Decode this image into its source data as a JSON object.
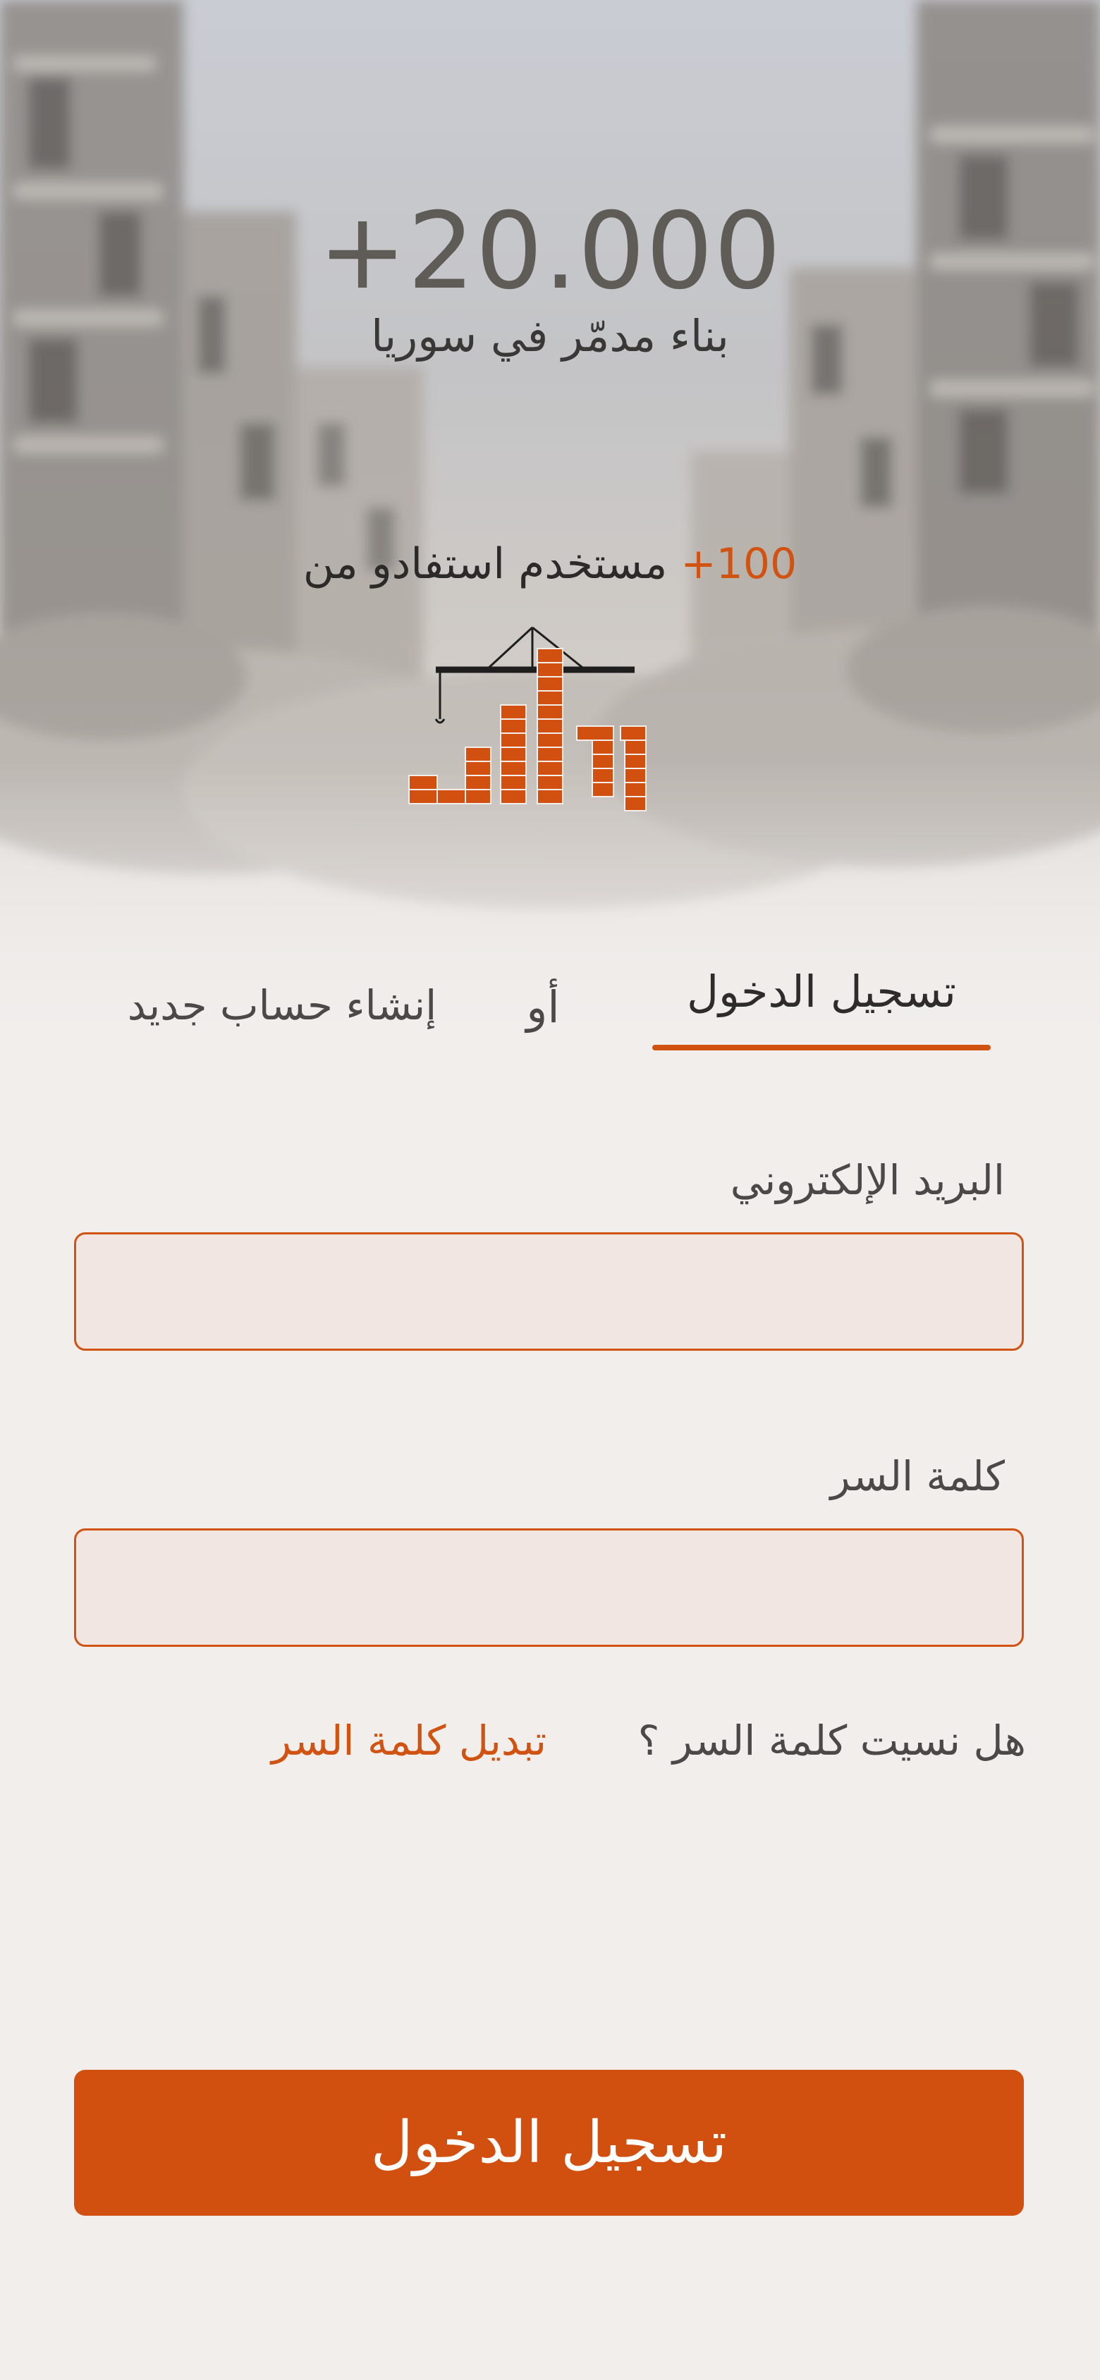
{
  "hero": {
    "stat_number": "+20.000",
    "stat_caption": "بناء مدمّر في سوريا",
    "users_count": "100+",
    "users_text": " مستخدم استفادو من"
  },
  "tabs": {
    "login_label": "تسجيل الدخول",
    "or_label": "أو",
    "register_label": "إنشاء حساب جديد"
  },
  "form": {
    "email_label": "البريد الإلكتروني",
    "email_value": "",
    "password_label": "كلمة السر",
    "password_value": "",
    "forgot_question": "هل نسيت كلمة السر ؟",
    "reset_link": "تبديل كلمة السر",
    "submit_label": "تسجيل الدخول"
  },
  "colors": {
    "accent": "#d1500f",
    "background": "#f1eeec",
    "input_fill": "#f2e6e2",
    "text_dark": "#2e2c2b"
  },
  "icons": {
    "logo": "crane-bricks-logo"
  }
}
